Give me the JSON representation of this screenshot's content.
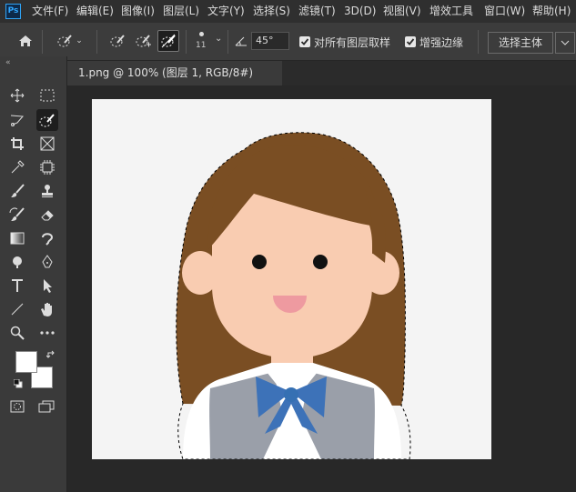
{
  "app": {
    "logo_text": "Ps"
  },
  "menu": [
    "文件(F)",
    "编辑(E)",
    "图像(I)",
    "图层(L)",
    "文字(Y)",
    "选择(S)",
    "滤镜(T)",
    "3D(D)",
    "视图(V)",
    "增效工具",
    "窗口(W)",
    "帮助(H)"
  ],
  "options": {
    "brush_size": "11",
    "angle_value": "45°",
    "sample_all_layers_label": "对所有图层取样",
    "sample_all_layers_checked": true,
    "enhance_edge_label": "增强边缘",
    "enhance_edge_checked": true,
    "select_subject_label": "选择主体"
  },
  "document": {
    "tab_title": "1.png @ 100% (图层 1, RGB/8#)"
  },
  "toolbar": {
    "tools": [
      "move-icon",
      "marquee-icon",
      "lasso-icon",
      "quick-selection-icon",
      "crop-icon",
      "frame-icon",
      "eyedropper-icon",
      "content-aware-icon",
      "brush-icon",
      "stamp-icon",
      "history-brush-icon",
      "eraser-icon",
      "gradient-icon",
      "blur-icon",
      "dodge-icon",
      "pen-icon",
      "type-icon",
      "path-selection-icon",
      "line-icon",
      "hand-icon",
      "zoom-icon",
      "more-icon"
    ],
    "foreground_color": "#ffffff",
    "background_color": "#ffffff"
  },
  "colors": {
    "hair": "#7a4e23",
    "skin": "#f9ccb1",
    "vest": "#9a9fa9",
    "bow": "#3d72b8",
    "mouth": "#ee9aa0",
    "canvas": "#f4f4f4"
  }
}
